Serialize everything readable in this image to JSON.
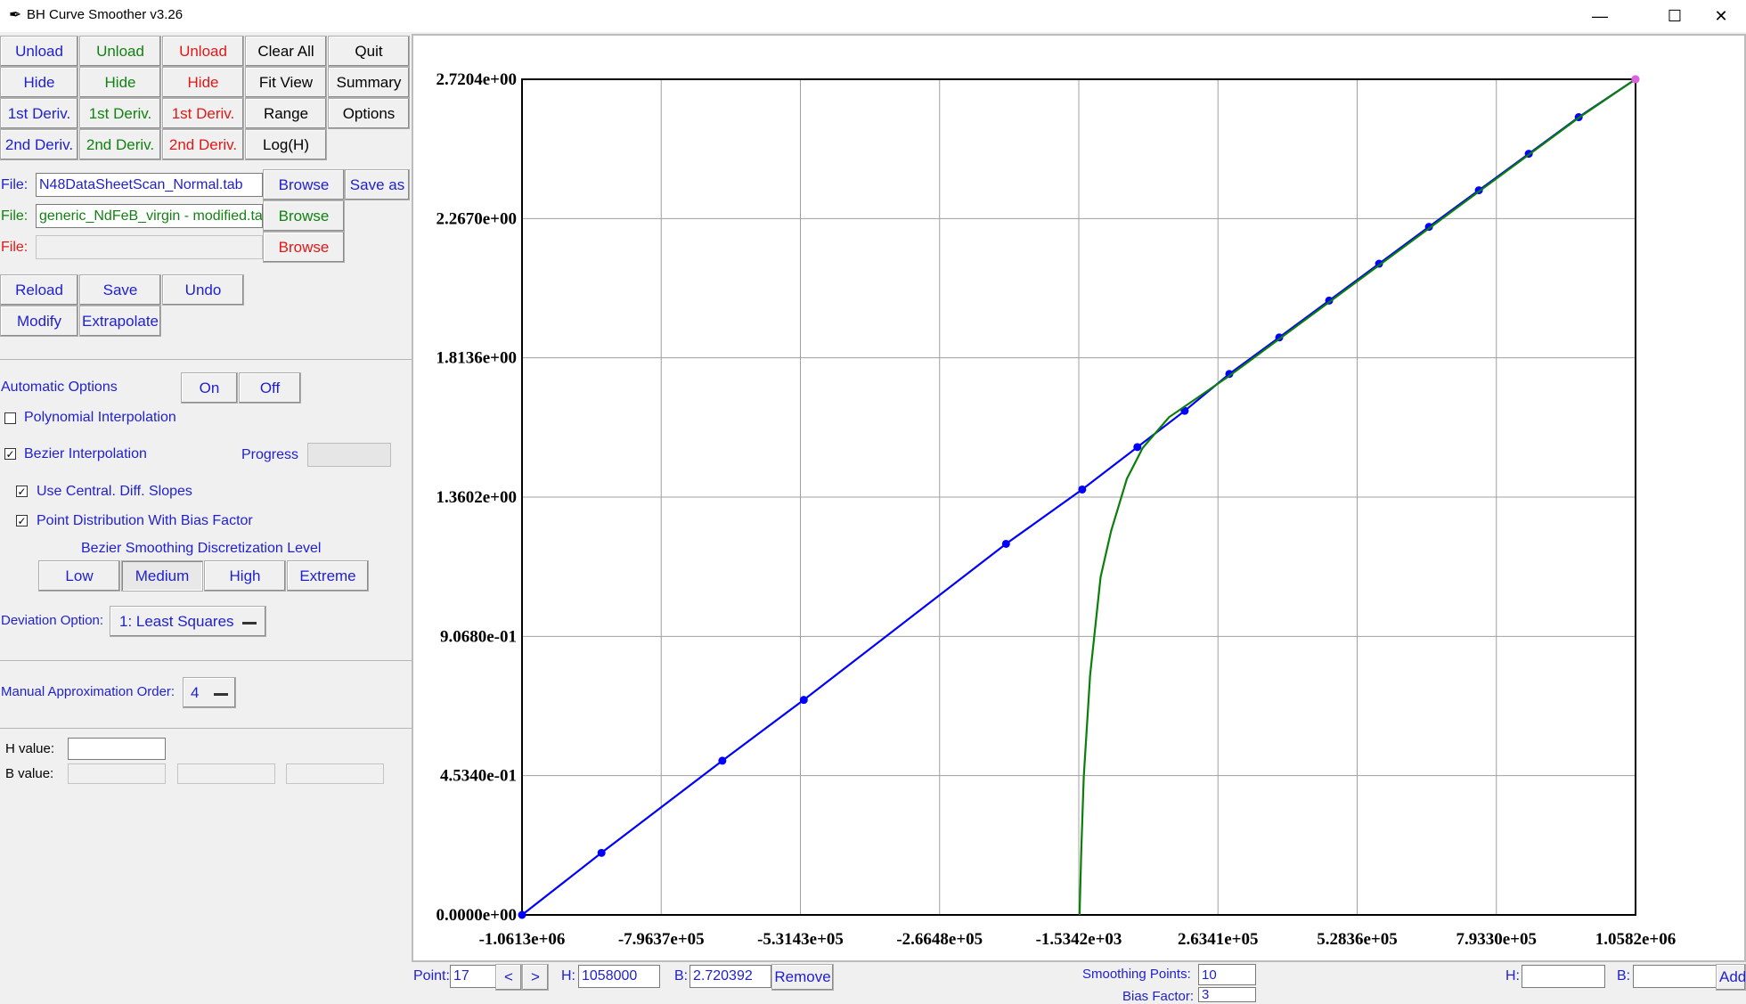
{
  "window": {
    "title": "BH Curve Smoother v3.26",
    "min": "—",
    "max": "☐",
    "close": "✕"
  },
  "buttons": {
    "row1": [
      "Unload",
      "Unload",
      "Unload",
      "Clear All",
      "Quit"
    ],
    "row2": [
      "Hide",
      "Hide",
      "Hide",
      "Fit View",
      "Summary"
    ],
    "row3": [
      "1st Deriv.",
      "1st Deriv.",
      "1st Deriv.",
      "Range",
      "Options"
    ],
    "row4": [
      "2nd Deriv.",
      "2nd Deriv.",
      "2nd Deriv.",
      "Log(H)"
    ]
  },
  "files": {
    "label": "File:",
    "file1": "N48DataSheetScan_Normal.tab",
    "file2": "generic_NdFeB_virgin - modified.ta",
    "file3": "",
    "browse": "Browse",
    "save_as": "Save as"
  },
  "actions": [
    "Reload",
    "Save",
    "Undo",
    "Modify",
    "Extrapolate"
  ],
  "options": {
    "automatic": "Automatic Options",
    "on": "On",
    "off": "Off",
    "polynomial": "Polynomial Interpolation",
    "bezier": "Bezier Interpolation",
    "progress": "Progress",
    "central_diff": "Use Central. Diff. Slopes",
    "bias_dist": "Point Distribution With Bias Factor",
    "level_title": "Bezier Smoothing Discretization Level",
    "levels": [
      "Low",
      "Medium",
      "High",
      "Extreme"
    ],
    "selected_level": "Medium",
    "deviation_label": "Deviation Option:",
    "deviation_value": "1: Least Squares",
    "manual_order_label": "Manual Approximation Order:",
    "manual_order_value": "4",
    "h_value_label": "H value:",
    "b_value_label": "B value:"
  },
  "bottom": {
    "point_label": "Point:",
    "point_value": "17",
    "prev": "<",
    "next": ">",
    "h_label": "H:",
    "h_value": "1058000",
    "b_label": "B:",
    "b_value": "2.720392",
    "remove": "Remove",
    "smoothing_label": "Smoothing Points:",
    "smoothing_value": "10",
    "bias_label": "Bias Factor:",
    "bias_value": "3",
    "h2_label": "H:",
    "b2_label": "B:",
    "add": "Add"
  },
  "chart_data": {
    "type": "line",
    "xlim": [
      -1061300,
      1058200
    ],
    "ylim": [
      0,
      2.7204
    ],
    "x_ticks": [
      "-1.0613e+06",
      "-7.9637e+05",
      "-5.3143e+05",
      "-2.6648e+05",
      "-1.5342e+03",
      "2.6341e+05",
      "5.2836e+05",
      "7.9330e+05",
      "1.0582e+06"
    ],
    "y_ticks": [
      "0.0000e+00",
      "4.5340e-01",
      "9.0680e-01",
      "1.3602e+00",
      "1.8136e+00",
      "2.2670e+00",
      "2.7204e+00"
    ],
    "grid": true,
    "series": [
      {
        "color": "#0000ff",
        "markers": true,
        "points": [
          [
            -1061300,
            0.0
          ],
          [
            -910000,
            0.202
          ],
          [
            -680000,
            0.502
          ],
          [
            -525000,
            0.7
          ],
          [
            -140000,
            1.208
          ],
          [
            5000,
            1.385
          ],
          [
            110000,
            1.523
          ],
          [
            200000,
            1.641
          ],
          [
            285000,
            1.761
          ],
          [
            380000,
            1.88
          ],
          [
            475000,
            2.0
          ],
          [
            570000,
            2.12
          ],
          [
            665000,
            2.24
          ],
          [
            760000,
            2.359
          ],
          [
            855000,
            2.478
          ],
          [
            950000,
            2.597
          ],
          [
            1058000,
            2.720392
          ]
        ]
      },
      {
        "color": "#0a7f0a",
        "markers": false,
        "points": [
          [
            0,
            0.0
          ],
          [
            3000,
            0.2
          ],
          [
            8000,
            0.45
          ],
          [
            20000,
            0.78
          ],
          [
            40000,
            1.1
          ],
          [
            60000,
            1.25
          ],
          [
            90000,
            1.42
          ],
          [
            120000,
            1.52
          ],
          [
            170000,
            1.62
          ],
          [
            285000,
            1.755
          ],
          [
            380000,
            1.875
          ],
          [
            475000,
            1.995
          ],
          [
            570000,
            2.115
          ],
          [
            665000,
            2.235
          ],
          [
            760000,
            2.355
          ],
          [
            855000,
            2.475
          ],
          [
            950000,
            2.595
          ],
          [
            1058000,
            2.7204
          ]
        ]
      }
    ],
    "highlight_point": [
      1058000,
      2.720392
    ],
    "highlight_color": "#e060e0"
  }
}
